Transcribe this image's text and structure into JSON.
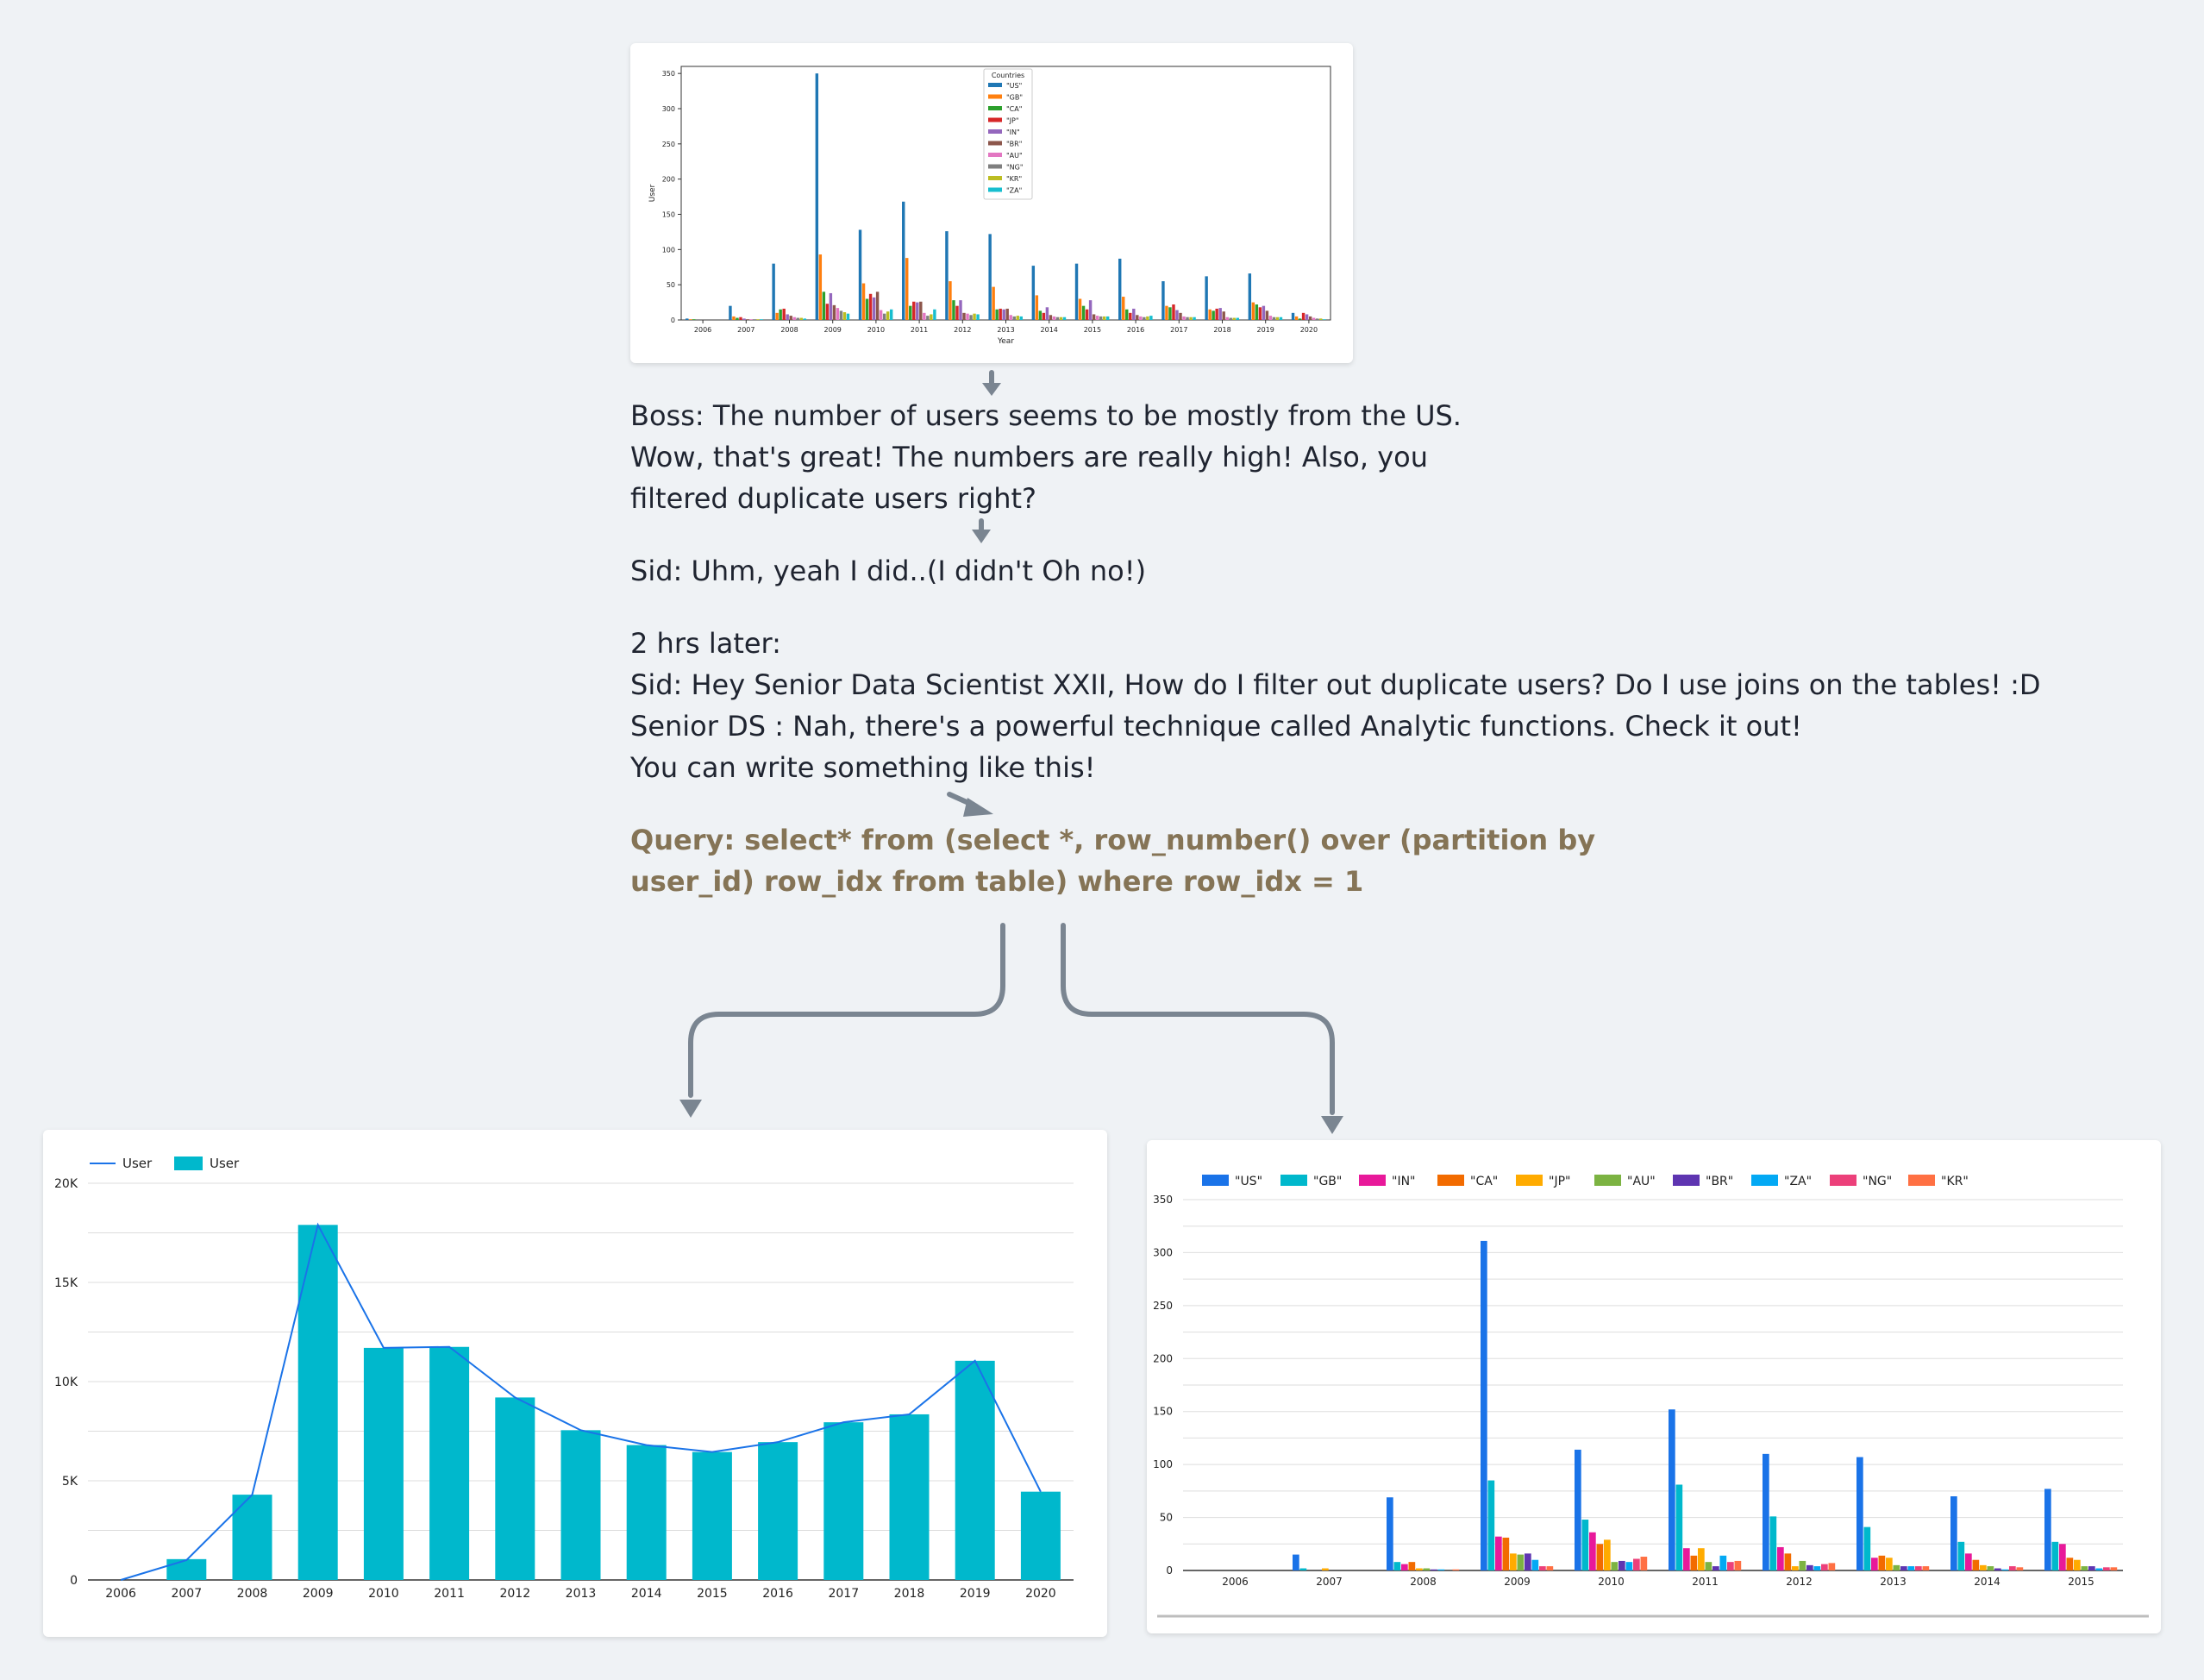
{
  "conversation": {
    "boss_lines": [
      "Boss: The number of users seems to be mostly from the US.",
      "Wow, that's great! The numbers are really high! Also, you",
      "filtered duplicate users right?"
    ],
    "sid_reply": "Sid: Uhm, yeah I did..(I didn't Oh no!)",
    "later_lines": [
      "2 hrs later:",
      "Sid: Hey Senior Data Scientist XXII, How do I filter out duplicate users? Do I use joins on the tables! :D",
      "Senior DS : Nah, there's a powerful technique called Analytic functions. Check it out!",
      "You can write something like this!"
    ],
    "query_lines": [
      "Query: select* from (select *, row_number() over (partition by",
      "user_id) row_idx from table) where row_idx = 1"
    ]
  },
  "colors": {
    "background": "#eff2f5",
    "text": "#1f2430",
    "query": "#857456",
    "arrow": "#7a8591",
    "bar_teal": "#00b8cc",
    "line_blue": "#1a73e8"
  },
  "chart_data": [
    {
      "type": "bar",
      "xlabel": "Year",
      "ylabel": "User",
      "legend_title": "Countries",
      "legend_position": "top-center",
      "ylim": [
        0,
        360
      ],
      "yticks": [
        0,
        50,
        100,
        150,
        200,
        250,
        300,
        350
      ],
      "categories": [
        "2006",
        "2007",
        "2008",
        "2009",
        "2010",
        "2011",
        "2012",
        "2013",
        "2014",
        "2015",
        "2016",
        "2017",
        "2018",
        "2019",
        "2020"
      ],
      "series": [
        {
          "name": "\"US\"",
          "color": "#1f77b4",
          "values": [
            2,
            20,
            80,
            350,
            128,
            168,
            126,
            122,
            77,
            80,
            87,
            55,
            62,
            66,
            10
          ]
        },
        {
          "name": "\"GB\"",
          "color": "#ff7f0e",
          "values": [
            1,
            5,
            10,
            93,
            52,
            88,
            55,
            47,
            35,
            30,
            33,
            20,
            15,
            25,
            5
          ]
        },
        {
          "name": "\"CA\"",
          "color": "#2ca02c",
          "values": [
            1,
            3,
            15,
            40,
            30,
            20,
            28,
            15,
            13,
            20,
            15,
            18,
            13,
            22,
            2
          ]
        },
        {
          "name": "\"JP\"",
          "color": "#d62728",
          "values": [
            0,
            4,
            16,
            23,
            37,
            26,
            20,
            16,
            10,
            15,
            10,
            22,
            16,
            18,
            10
          ]
        },
        {
          "name": "\"IN\"",
          "color": "#9467bd",
          "values": [
            0,
            2,
            8,
            38,
            32,
            25,
            28,
            15,
            18,
            28,
            16,
            14,
            17,
            20,
            8
          ]
        },
        {
          "name": "\"BR\"",
          "color": "#8c564b",
          "values": [
            0,
            1,
            6,
            21,
            40,
            26,
            10,
            16,
            7,
            8,
            7,
            10,
            12,
            13,
            5
          ]
        },
        {
          "name": "\"AU\"",
          "color": "#e377c2",
          "values": [
            0,
            1,
            4,
            17,
            14,
            10,
            9,
            7,
            5,
            6,
            5,
            5,
            4,
            6,
            3
          ]
        },
        {
          "name": "\"NG\"",
          "color": "#7f7f7f",
          "values": [
            0,
            1,
            3,
            13,
            9,
            6,
            7,
            5,
            4,
            5,
            4,
            4,
            3,
            4,
            2
          ]
        },
        {
          "name": "\"KR\"",
          "color": "#bcbd22",
          "values": [
            0,
            1,
            3,
            11,
            12,
            8,
            9,
            6,
            4,
            5,
            5,
            4,
            3,
            4,
            2
          ]
        },
        {
          "name": "\"ZA\"",
          "color": "#17becf",
          "values": [
            0,
            1,
            2,
            9,
            15,
            15,
            8,
            5,
            4,
            5,
            6,
            4,
            3,
            4,
            1
          ]
        }
      ]
    },
    {
      "type": "bar",
      "legend_position": "top-left",
      "ylim": [
        0,
        20000
      ],
      "yticks": [
        0,
        5000,
        10000,
        15000,
        20000
      ],
      "ytick_labels": [
        "0",
        "5K",
        "10K",
        "15K",
        "20K"
      ],
      "categories": [
        "2006",
        "2007",
        "2008",
        "2009",
        "2010",
        "2011",
        "2012",
        "2013",
        "2014",
        "2015",
        "2016",
        "2017",
        "2018",
        "2019",
        "2020"
      ],
      "series": [
        {
          "name": "User",
          "kind": "line",
          "color": "#1a73e8",
          "values": [
            0,
            1000,
            4300,
            17900,
            11700,
            11750,
            9200,
            7550,
            6800,
            6450,
            6950,
            7950,
            8350,
            11050,
            4450
          ]
        },
        {
          "name": "User",
          "kind": "bar",
          "color": "#00b8cc",
          "values": [
            0,
            1050,
            4300,
            17900,
            11700,
            11750,
            9200,
            7550,
            6800,
            6450,
            6950,
            7950,
            8350,
            11050,
            4450
          ]
        }
      ]
    },
    {
      "type": "bar",
      "legend_position": "top-left",
      "ylim": [
        0,
        350
      ],
      "yticks": [
        0,
        50,
        100,
        150,
        200,
        250,
        300,
        350
      ],
      "categories": [
        "2006",
        "2007",
        "2008",
        "2009",
        "2010",
        "2011",
        "2012",
        "2013",
        "2014",
        "2015"
      ],
      "series": [
        {
          "name": "\"US\"",
          "color": "#1a73e8",
          "values": [
            0,
            15,
            69,
            311,
            114,
            152,
            110,
            107,
            70,
            77
          ]
        },
        {
          "name": "\"GB\"",
          "color": "#00b8cc",
          "values": [
            0,
            2,
            8,
            85,
            48,
            81,
            51,
            41,
            27,
            27
          ]
        },
        {
          "name": "\"IN\"",
          "color": "#e8199a",
          "values": [
            0,
            0,
            6,
            32,
            36,
            21,
            22,
            12,
            16,
            25
          ]
        },
        {
          "name": "\"CA\"",
          "color": "#f26b00",
          "values": [
            0,
            0,
            8,
            31,
            25,
            14,
            16,
            14,
            10,
            12
          ]
        },
        {
          "name": "\"JP\"",
          "color": "#ffab00",
          "values": [
            0,
            2,
            2,
            16,
            29,
            21,
            4,
            12,
            5,
            10
          ]
        },
        {
          "name": "\"AU\"",
          "color": "#7cb342",
          "values": [
            0,
            0,
            2,
            15,
            8,
            8,
            9,
            5,
            4,
            4
          ]
        },
        {
          "name": "\"BR\"",
          "color": "#5e35b1",
          "values": [
            0,
            0,
            1,
            16,
            9,
            4,
            5,
            4,
            2,
            4
          ]
        },
        {
          "name": "\"ZA\"",
          "color": "#03a9f4",
          "values": [
            0,
            0,
            1,
            10,
            8,
            14,
            4,
            4,
            1,
            2
          ]
        },
        {
          "name": "\"NG\"",
          "color": "#ec407a",
          "values": [
            0,
            0,
            0,
            4,
            11,
            8,
            6,
            4,
            4,
            3
          ]
        },
        {
          "name": "\"KR\"",
          "color": "#ff7043",
          "values": [
            0,
            0,
            1,
            4,
            13,
            9,
            7,
            4,
            3,
            3
          ]
        }
      ]
    }
  ]
}
